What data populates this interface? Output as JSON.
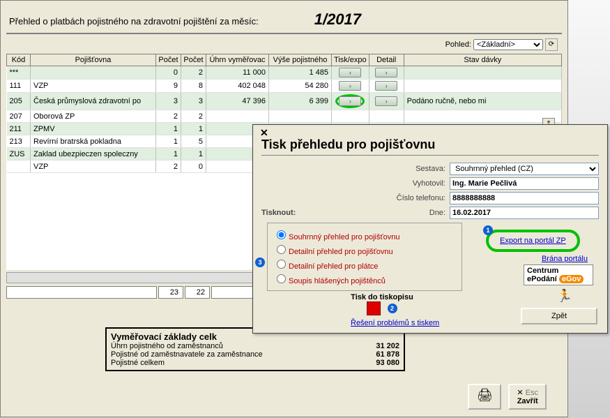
{
  "header": {
    "title": "Přehled o platbách pojistného na zdravotní pojištění za měsíc:",
    "period": "1/2017",
    "pohled_label": "Pohled:",
    "pohled_value": "<Základní>"
  },
  "columns": [
    "Kód",
    "Pojišťovna",
    "Počet",
    "Počet",
    "Úhrn vyměřovac",
    "Výše pojistného",
    "Tisk/expo",
    "Detail",
    "Stav dávky"
  ],
  "rows": [
    {
      "kod": "***",
      "nazev": "",
      "p1": "0",
      "p2": "2",
      "uhrn": "11 000",
      "vyse": "1 485",
      "stav": ""
    },
    {
      "kod": "111",
      "nazev": "VZP",
      "p1": "9",
      "p2": "8",
      "uhrn": "402 048",
      "vyse": "54 280",
      "stav": ""
    },
    {
      "kod": "205",
      "nazev": "Česká průmyslová zdravotní po",
      "p1": "3",
      "p2": "3",
      "uhrn": "47 396",
      "vyse": "6 399",
      "stav": "Podáno ručně, nebo mi"
    },
    {
      "kod": "207",
      "nazev": "Oborová ZP",
      "p1": "2",
      "p2": "2",
      "uhrn": "",
      "vyse": "",
      "stav": ""
    },
    {
      "kod": "211",
      "nazev": "ZPMV",
      "p1": "1",
      "p2": "1",
      "uhrn": "",
      "vyse": "",
      "stav": ""
    },
    {
      "kod": "213",
      "nazev": "Revírní bratrská pokladna",
      "p1": "1",
      "p2": "5",
      "uhrn": "",
      "vyse": "",
      "stav": ""
    },
    {
      "kod": "ZUS",
      "nazev": "Zaklad ubezpieczen spoleczny",
      "p1": "1",
      "p2": "1",
      "uhrn": "",
      "vyse": "",
      "stav": ""
    },
    {
      "kod": "",
      "nazev": "VZP",
      "p1": "2",
      "p2": "0",
      "uhrn": "",
      "vyse": "",
      "stav": ""
    }
  ],
  "footer_totals": {
    "c1": "23",
    "c2": "22"
  },
  "summary": {
    "title": "Vyměřovací základy celk",
    "rows": [
      {
        "label": "Úhrn pojistného od zaměstnanců",
        "val": "31 202"
      },
      {
        "label": "Pojistné od zaměstnavatele za zaměstnance",
        "val": "61 878"
      },
      {
        "label": "Pojistné celkem",
        "val": "93 080"
      }
    ]
  },
  "bottom": {
    "print_icon": "🖨",
    "esc": "Esc",
    "zavrit": "Zavřít"
  },
  "nav_arrows": [
    "⤒",
    "⇧",
    "↑",
    "↓",
    "⇩",
    "⤓"
  ],
  "dialog": {
    "title": "Tisk přehledu pro pojišťovnu",
    "fields": {
      "sestava_label": "Sestava:",
      "sestava_value": "Souhrnný přehled (CZ)",
      "vyhotovil_label": "Vyhotovil:",
      "vyhotovil_value": "Ing. Marie Pečlivá",
      "tel_label": "Číslo telefonu:",
      "tel_value": "8888888888",
      "dne_label": "Dne:",
      "dne_value": "16.02.2017",
      "tisknout_label": "Tisknout:"
    },
    "print_options": [
      "Souhrnný přehled pro pojišťovnu",
      "Detailní přehled pro pojišťovnu",
      "Detailní přehled pro plátce",
      "Soupis hlášených pojištěnců"
    ],
    "export_label": "Export na portál ZP",
    "brana_label": "Brána portálu",
    "centrum_label": "Centrum ePodání",
    "tiskdo_label": "Tisk do tiskopisu",
    "reseni_label": "Řešení problémů s tiskem",
    "zpet_label": "Zpět",
    "badges": {
      "export": "1",
      "tiskdo": "2",
      "option3": "3"
    }
  }
}
